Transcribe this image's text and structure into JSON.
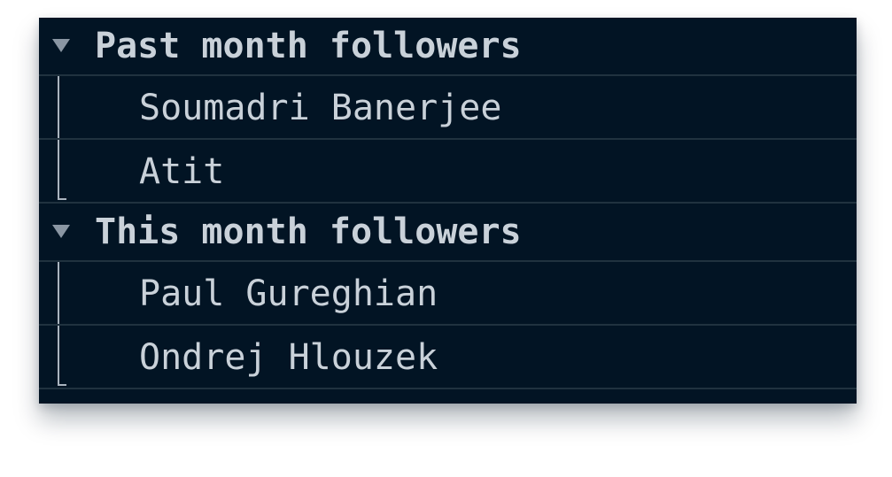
{
  "groups": [
    {
      "title": "Past month followers",
      "expanded": true,
      "caret_icon": "triangle-down-icon",
      "members": [
        "Soumadri Banerjee",
        "Atit"
      ]
    },
    {
      "title": "This month followers",
      "expanded": true,
      "caret_icon": "triangle-down-icon",
      "members": [
        "Paul Gureghian",
        "Ondrej Hlouzek"
      ]
    }
  ],
  "colors": {
    "panel_background": "#021424",
    "row_divider": "#20323f",
    "text": "#c9d1d9",
    "caret": "#8a96a3",
    "tree_line": "#aab4bf"
  }
}
